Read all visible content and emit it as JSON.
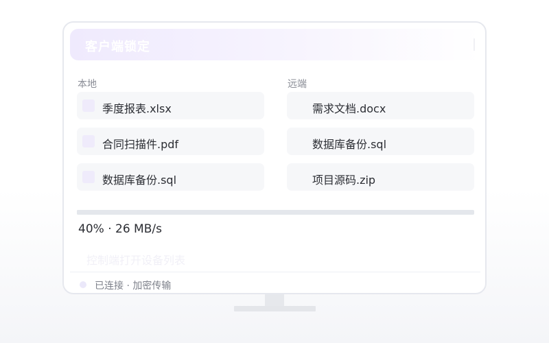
{
  "window": {
    "title": "客户端锁定"
  },
  "local": {
    "label": "本地",
    "files": [
      {
        "name": "季度报表.xlsx"
      },
      {
        "name": "合同扫描件.pdf"
      },
      {
        "name": "数据库备份.sql"
      }
    ]
  },
  "remote": {
    "label": "远端",
    "files": [
      {
        "name": "需求文档.docx"
      },
      {
        "name": "数据库备份.sql"
      },
      {
        "name": "项目源码.zip"
      }
    ]
  },
  "transfer": {
    "progress_percent": 40,
    "status_text": "40% · 26 MB/s"
  },
  "command_hint": "控制端打开设备列表",
  "status": {
    "text": "已连接 · 加密传输"
  },
  "colors": {
    "accent_light": "#efeafd",
    "progress_track": "#e4e7ec"
  }
}
